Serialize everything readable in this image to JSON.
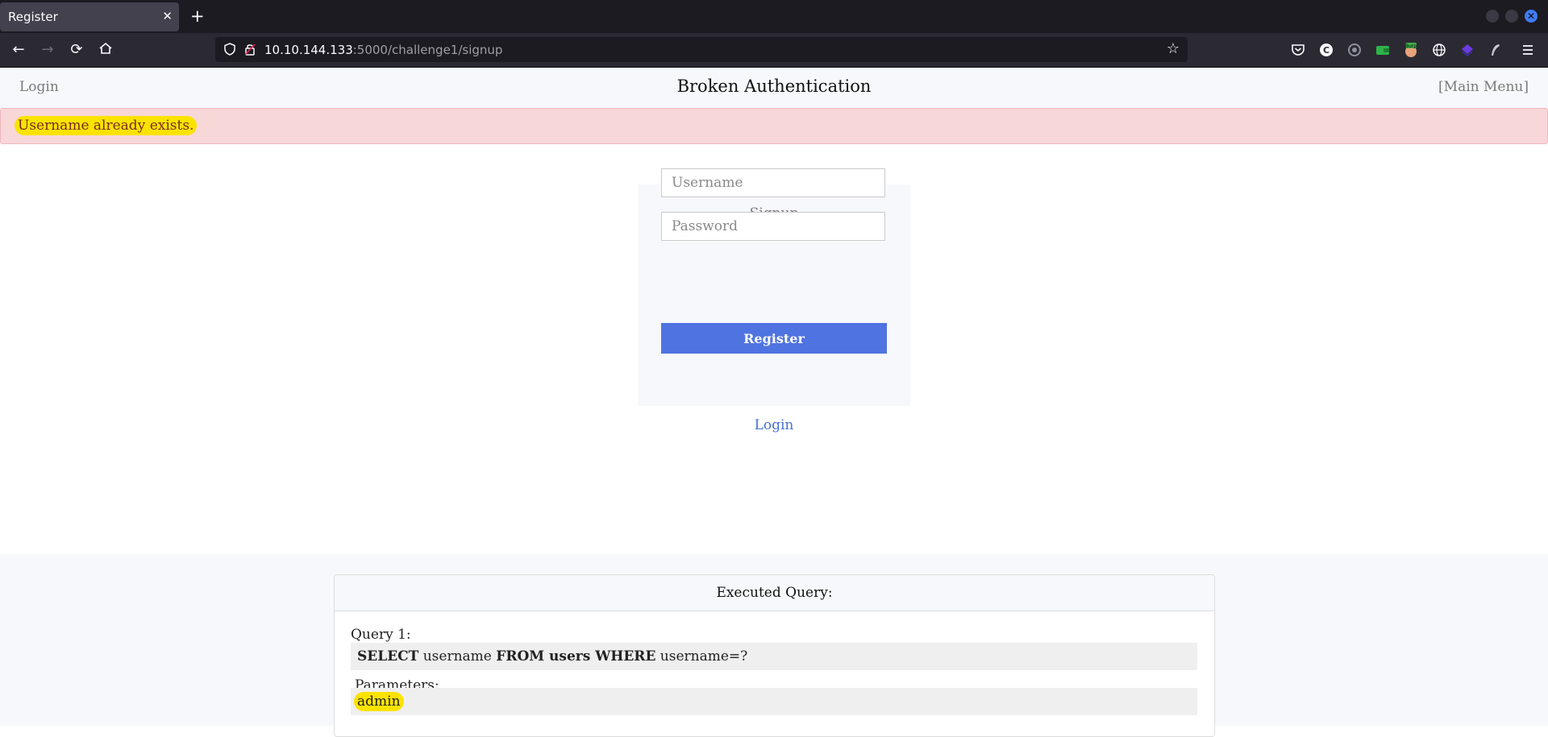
{
  "browser": {
    "tab_title": "Register",
    "tab_close": "✕",
    "new_tab": "+",
    "url_host": "10.10.144.133",
    "url_path": ":5000/challenge1/signup",
    "extension_badge": "Burp"
  },
  "page": {
    "nav_login": "Login",
    "title": "Broken Authentication",
    "main_menu": "[Main Menu]",
    "alert": "Username already exists.",
    "signup": {
      "heading": "Signup",
      "username_placeholder": "Username",
      "password_placeholder": "Password",
      "register_button": "Register",
      "login_link": "Login"
    },
    "query": {
      "header": "Executed Query:",
      "label": "Query 1:",
      "sql_parts": [
        "SELECT",
        " username ",
        "FROM users WHERE",
        " username=?"
      ],
      "params_label": "Parameters:",
      "param_value": "admin"
    }
  },
  "colors": {
    "accent": "#4f73e0",
    "alert_bg": "#f8d7d9",
    "highlight": "#fbe300"
  }
}
